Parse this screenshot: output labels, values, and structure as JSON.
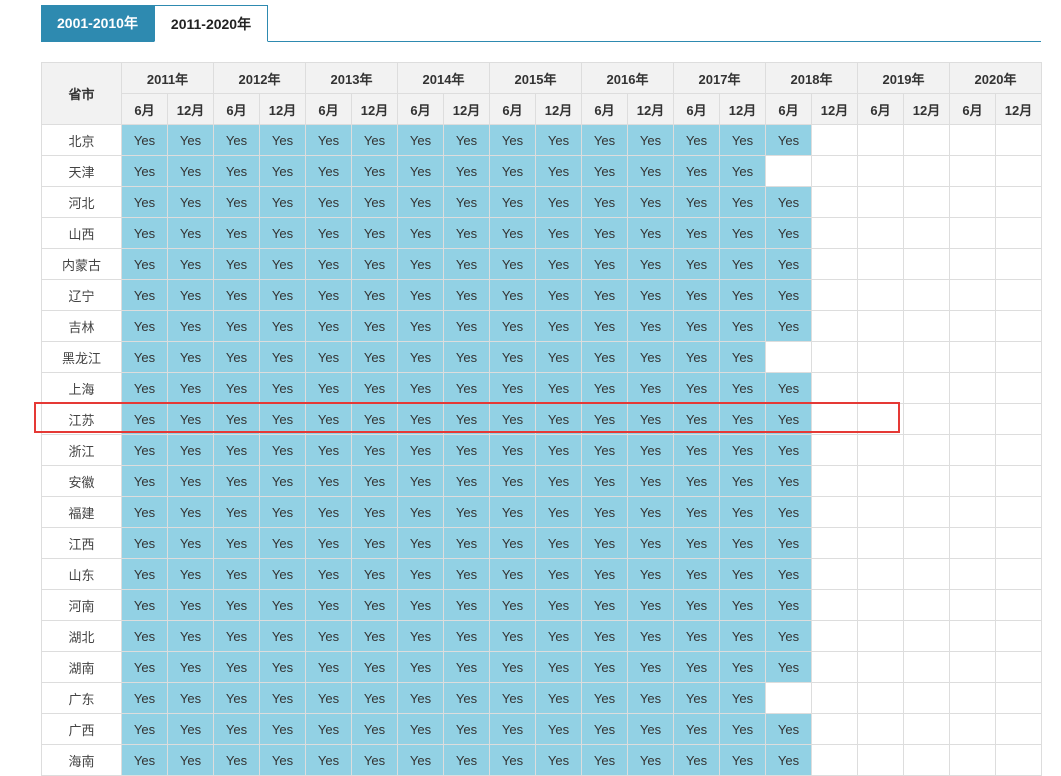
{
  "tabs": [
    "2001-2010年",
    "2011-2020年"
  ],
  "table": {
    "corner_label": "省市",
    "years": [
      "2011年",
      "2012年",
      "2013年",
      "2014年",
      "2015年",
      "2016年",
      "2017年",
      "2018年",
      "2019年",
      "2020年"
    ],
    "months": [
      "6月",
      "12月"
    ],
    "rows": [
      {
        "province": "北京",
        "count": 15
      },
      {
        "province": "天津",
        "count": 14
      },
      {
        "province": "河北",
        "count": 15
      },
      {
        "province": "山西",
        "count": 15
      },
      {
        "province": "内蒙古",
        "count": 15
      },
      {
        "province": "辽宁",
        "count": 15
      },
      {
        "province": "吉林",
        "count": 15
      },
      {
        "province": "黑龙江",
        "count": 14
      },
      {
        "province": "上海",
        "count": 15
      },
      {
        "province": "江苏",
        "count": 15
      },
      {
        "province": "浙江",
        "count": 15
      },
      {
        "province": "安徽",
        "count": 15
      },
      {
        "province": "福建",
        "count": 15
      },
      {
        "province": "江西",
        "count": 15
      },
      {
        "province": "山东",
        "count": 15
      },
      {
        "province": "河南",
        "count": 15
      },
      {
        "province": "湖北",
        "count": 15
      },
      {
        "province": "湖南",
        "count": 15
      },
      {
        "province": "广东",
        "count": 14
      },
      {
        "province": "广西",
        "count": 15
      },
      {
        "province": "海南",
        "count": 15
      }
    ],
    "cell_value": "Yes"
  },
  "colors": {
    "tab_active": "#2e8ab0",
    "cell_yes": "#92d1e4",
    "highlight": "#e53935",
    "header_bg": "#f2f2f2"
  }
}
